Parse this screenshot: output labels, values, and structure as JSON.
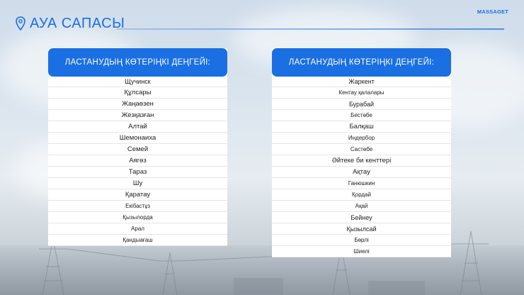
{
  "header": {
    "title": "АУА САПАСЫ",
    "brand": "MASSAGET",
    "pin_icon": "location-pin-icon",
    "accent_color": "#1a6fe3"
  },
  "left_panel": {
    "heading": "ЛАСТАНУДЫҢ КӨТЕРІҢКІ ДЕҢГЕЙІ:",
    "items": [
      "Щучинск",
      "Құлсары",
      "Жаңаөзен",
      "Жезқазған",
      "Алтай",
      "Шемонаиха",
      "Семей",
      "Аягөз",
      "Тараз",
      "Шу",
      "Қаратау",
      "Екібастұз",
      "Қызылорда",
      "Арал",
      "Қандыағаш"
    ]
  },
  "right_panel": {
    "heading": "ЛАСТАНУДЫҢ КӨТЕРІҢКІ ДЕҢГЕЙІ:",
    "items": [
      "Жаркент",
      "Кентау қалалары",
      "Бурабай",
      "Бестөбе",
      "Балқаш",
      "Индербор",
      "Састөбе",
      "Әйтеке би кенттері",
      "Ақтау",
      "Ганюшкин",
      "Қордай",
      "Ақай",
      "Бейнеу",
      "Қызылсай",
      "Бөрлі",
      "Шиелі"
    ]
  }
}
